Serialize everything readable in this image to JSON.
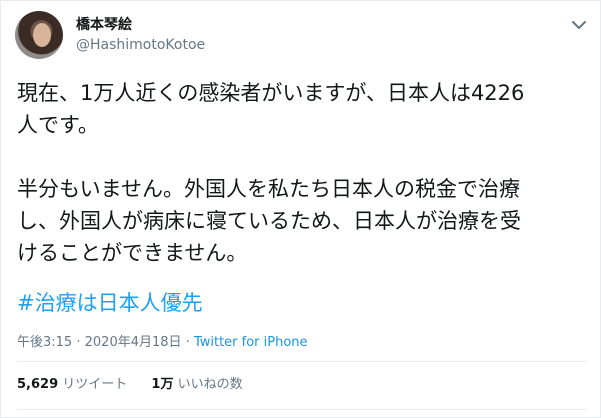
{
  "user": {
    "display_name": "橋本琴絵",
    "handle": "@HashimotoKotoe"
  },
  "icons": {
    "avatar": "profile-photo",
    "caret": "chevron-down-icon"
  },
  "tweet": {
    "paragraphs": [
      [
        "現在、1万人近くの感染者がいますが、日本人は4226",
        "人です。"
      ],
      [
        "半分もいません。外国人を私たち日本人の税金で治療",
        "し、外国人が病床に寝ているため、日本人が治療を受",
        "けることができません。"
      ]
    ],
    "hashtag": "#治療は日本人優先"
  },
  "meta": {
    "time": "午後3:15",
    "separator": "·",
    "date": "2020年4月18日",
    "source": "Twitter for iPhone"
  },
  "stats": {
    "retweets_count": "5,629",
    "retweets_label": "リツイート",
    "likes_count": "1万",
    "likes_label": "いいねの数"
  },
  "colors": {
    "link": "#1da1f2",
    "source": "#1b95e0",
    "secondary_text": "#657786",
    "primary_text": "#14171a",
    "border": "#e6ecf0"
  }
}
